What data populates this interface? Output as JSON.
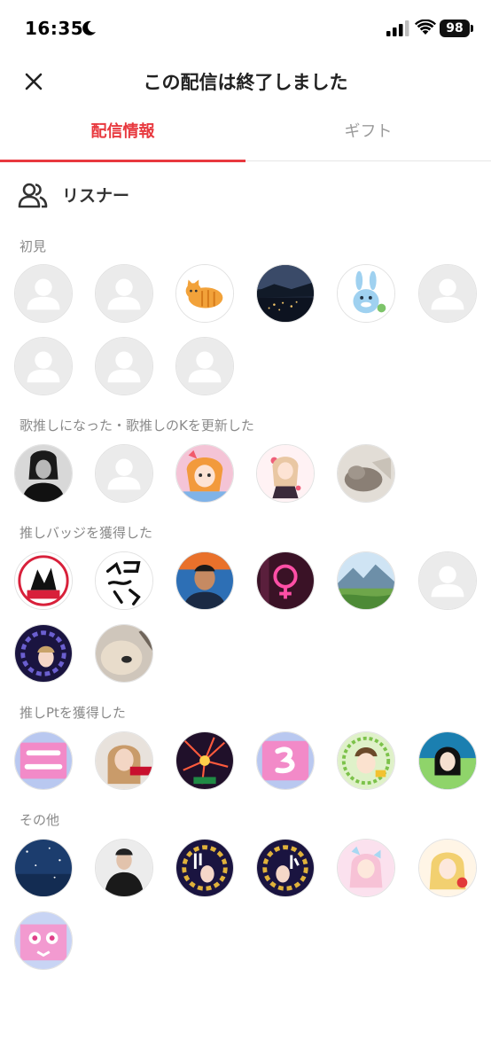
{
  "status_bar": {
    "time": "16:35",
    "battery": "98",
    "icons": [
      "moon-icon",
      "signal-icon",
      "wifi-icon",
      "battery-icon"
    ]
  },
  "header": {
    "title": "この配信は終了しました",
    "close_icon": "close-icon"
  },
  "tabs": [
    {
      "label": "配信情報",
      "active": true
    },
    {
      "label": "ギフト",
      "active": false
    }
  ],
  "listeners": {
    "label": "リスナー",
    "icon": "users-icon"
  },
  "sections": [
    {
      "title": "初見",
      "count": 9
    },
    {
      "title": "歌推しになった・歌推しのKを更新した",
      "count": 5
    },
    {
      "title": "推しバッジを獲得した",
      "count": 8
    },
    {
      "title": "推しPtを獲得した",
      "count": 6
    },
    {
      "title": "その他",
      "count": 7
    }
  ],
  "colors": {
    "accent": "#e8393f",
    "inactive_tab": "#9a9a9a",
    "section_title": "#8a8a8a",
    "placeholder_avatar": "#ebebeb"
  }
}
